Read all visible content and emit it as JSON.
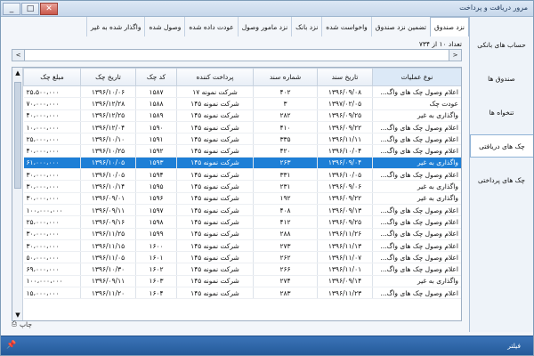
{
  "window": {
    "title": "مرور دریافت و پرداخت"
  },
  "sidebar": {
    "items": [
      {
        "label": "حساب های بانکی",
        "active": false
      },
      {
        "label": "صندوق ها",
        "active": false
      },
      {
        "label": "تنخواه ها",
        "active": false
      },
      {
        "label": "چک های دریافتی",
        "active": true
      },
      {
        "label": "چک های پرداختی",
        "active": false
      }
    ]
  },
  "tabs": [
    "نزد صندوق",
    "تضمین نزد صندوق",
    "واخواست شده",
    "نزد بانک",
    "نزد مامور وصول",
    "عودت داده شده",
    "وصول شده",
    "واگذار شده به غیر"
  ],
  "count": "تعداد ۱۰ از ۷۳۴",
  "table": {
    "headers": [
      "نوع عملیات",
      "تاریخ سند",
      "شماره سند",
      "پرداخت کننده",
      "کد چک",
      "تاریخ چک",
      "مبلغ چک"
    ],
    "rows": [
      [
        "اعلام وصول چک های واگ...",
        "۱۳۹۶/۰۹/۰۸",
        "۴۰۲",
        "شرکت نمونه ۱۷",
        "۱۵۸۷",
        "۱۳۹۶/۱۰/۰۶",
        "۲۵،۵۰۰،۰۰۰"
      ],
      [
        "عودت چک",
        "۱۳۹۷/۰۲/۰۵",
        "۳",
        "شرکت نمونه ۱۴۵",
        "۱۵۸۸",
        "۱۳۹۶/۱۲/۲۸",
        "۷۰،۰۰۰،۰۰۰"
      ],
      [
        "واگذاری به غیر",
        "۱۳۹۶/۰۹/۲۵",
        "۲۸۲",
        "شرکت نمونه ۱۴۵",
        "۱۵۸۹",
        "۱۳۹۶/۱۲/۲۵",
        "۴۰،۰۰۰،۰۰۰"
      ],
      [
        "اعلام وصول چک های واگ...",
        "۱۳۹۶/۰۹/۲۲",
        "۴۱۰",
        "شرکت نمونه ۱۴۵",
        "۱۵۹۰",
        "۱۳۹۶/۱۲/۰۴",
        "۱۰،۰۰۰،۰۰۰"
      ],
      [
        "اعلام وصول چک های واگ...",
        "۱۳۹۶/۱۱/۱۱",
        "۳۳۵",
        "شرکت نمونه ۱۴۵",
        "۱۵۹۱",
        "۱۳۹۶/۱۰/۱۰",
        "۲۵،۰۰۰،۰۰۰"
      ],
      [
        "اعلام وصول چک های واگ...",
        "۱۳۹۶/۱۰/۰۴",
        "۴۲۰",
        "شرکت نمونه ۱۴۵",
        "۱۵۹۲",
        "۱۳۹۶/۱۰/۲۵",
        "۴۰،۰۰۰،۰۰۰"
      ],
      [
        "واگذاری به غیر",
        "۱۳۹۶/۰۹/۰۴",
        "۲۶۳",
        "شرکت نمونه ۱۴۵",
        "۱۵۹۳",
        "۱۳۹۶/۱۰/۰۵",
        "۶۱،۰۰۰،۰۰۰"
      ],
      [
        "اعلام وصول چک های واگ...",
        "۱۳۹۶/۱۰/۰۵",
        "۳۳۱",
        "شرکت نمونه ۱۴۵",
        "۱۵۹۴",
        "۱۳۹۶/۱۰/۰۵",
        "۳۰،۰۰۰،۰۰۰"
      ],
      [
        "واگذاری به غیر",
        "۱۳۹۶/۰۹/۰۶",
        "۲۳۱",
        "شرکت نمونه ۱۴۵",
        "۱۵۹۵",
        "۱۳۹۶/۱۰/۱۴",
        "۳۰،۰۰۰،۰۰۰"
      ],
      [
        "واگذاری به غیر",
        "۱۳۹۶/۰۹/۲۲",
        "۱۹۲",
        "شرکت نمونه ۱۴۵",
        "۱۵۹۶",
        "۱۳۹۶/۰۹/۰۱",
        "۳۰،۰۰۰،۰۰۰"
      ],
      [
        "اعلام وصول چک های واگ...",
        "۱۳۹۶/۰۹/۱۳",
        "۴۰۸",
        "شرکت نمونه ۱۴۵",
        "۱۵۹۷",
        "۱۳۹۶/۰۹/۱۱",
        "۱۰۰،۰۰۰،۰۰۰"
      ],
      [
        "اعلام وصول چک های واگ...",
        "۱۳۹۶/۰۹/۲۵",
        "۴۱۲",
        "شرکت نمونه ۱۴۵",
        "۱۵۹۸",
        "۱۳۹۶/۰۹/۱۶",
        "۲۵،۰۰۰،۰۰۰"
      ],
      [
        "اعلام وصول چک های واگ...",
        "۱۳۹۶/۱۱/۲۶",
        "۲۸۸",
        "شرکت نمونه ۱۴۵",
        "۱۵۹۹",
        "۱۳۹۶/۱۱/۲۵",
        "۳۰،۰۰۰،۰۰۰"
      ],
      [
        "اعلام وصول چک های واگ...",
        "۱۳۹۶/۱۱/۱۳",
        "۲۷۳",
        "شرکت نمونه ۱۴۵",
        "۱۶۰۰",
        "۱۳۹۶/۱۱/۱۵",
        "۳۰،۰۰۰،۰۰۰"
      ],
      [
        "اعلام وصول چک های واگ...",
        "۱۳۹۶/۱۱/۰۷",
        "۲۶۲",
        "شرکت نمونه ۱۴۵",
        "۱۶۰۱",
        "۱۳۹۶/۱۱/۰۵",
        "۵۰،۰۰۰،۰۰۰"
      ],
      [
        "اعلام وصول چک های واگ...",
        "۱۳۹۶/۱۱/۰۱",
        "۲۶۶",
        "شرکت نمونه ۱۴۵",
        "۱۶۰۲",
        "۱۳۹۶/۱۰/۳۰",
        "۶۹،۰۰۰،۰۰۰"
      ],
      [
        "واگذاری به غیر",
        "۱۳۹۶/۰۹/۱۴",
        "۲۷۴",
        "شرکت نمونه ۱۴۵",
        "۱۶۰۳",
        "۱۳۹۶/۰۹/۱۱",
        "۱۰۰،۰۰۰،۰۰۰"
      ],
      [
        "اعلام وصول چک های واگ...",
        "۱۳۹۶/۱۱/۲۳",
        "۲۸۳",
        "شرکت نمونه ۱۴۵",
        "۱۶۰۴",
        "۱۳۹۶/۱۱/۲۰",
        "۱۵،۰۰۰،۰۰۰"
      ]
    ],
    "selected_index": 6
  },
  "print_label": "چاپ",
  "footer": {
    "label": "فیلتر"
  }
}
